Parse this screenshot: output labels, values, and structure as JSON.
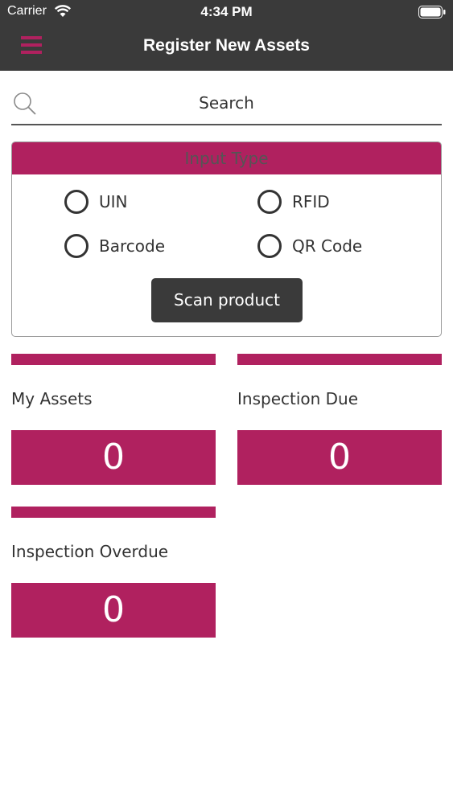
{
  "status_bar": {
    "carrier": "Carrier",
    "time": "4:34 PM"
  },
  "header": {
    "title": "Register New Assets"
  },
  "search": {
    "placeholder": "Search"
  },
  "input_type": {
    "title": "Input Type",
    "options": [
      "UIN",
      "RFID",
      "Barcode",
      "QR Code"
    ],
    "scan_label": "Scan product"
  },
  "stats": [
    {
      "label": "My Assets",
      "value": "0"
    },
    {
      "label": "Inspection Due",
      "value": "0"
    },
    {
      "label": "Inspection Overdue",
      "value": "0"
    }
  ],
  "colors": {
    "accent": "#b0215f",
    "topbar": "#3a3a3a"
  }
}
